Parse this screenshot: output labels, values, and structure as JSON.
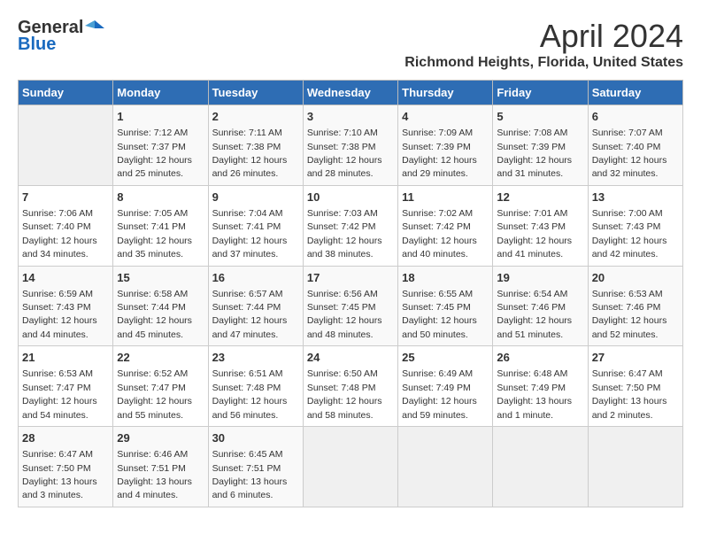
{
  "logo": {
    "general": "General",
    "blue": "Blue"
  },
  "title": "April 2024",
  "subtitle": "Richmond Heights, Florida, United States",
  "weekdays": [
    "Sunday",
    "Monday",
    "Tuesday",
    "Wednesday",
    "Thursday",
    "Friday",
    "Saturday"
  ],
  "weeks": [
    [
      {
        "day": "",
        "content": ""
      },
      {
        "day": "1",
        "content": "Sunrise: 7:12 AM\nSunset: 7:37 PM\nDaylight: 12 hours\nand 25 minutes."
      },
      {
        "day": "2",
        "content": "Sunrise: 7:11 AM\nSunset: 7:38 PM\nDaylight: 12 hours\nand 26 minutes."
      },
      {
        "day": "3",
        "content": "Sunrise: 7:10 AM\nSunset: 7:38 PM\nDaylight: 12 hours\nand 28 minutes."
      },
      {
        "day": "4",
        "content": "Sunrise: 7:09 AM\nSunset: 7:39 PM\nDaylight: 12 hours\nand 29 minutes."
      },
      {
        "day": "5",
        "content": "Sunrise: 7:08 AM\nSunset: 7:39 PM\nDaylight: 12 hours\nand 31 minutes."
      },
      {
        "day": "6",
        "content": "Sunrise: 7:07 AM\nSunset: 7:40 PM\nDaylight: 12 hours\nand 32 minutes."
      }
    ],
    [
      {
        "day": "7",
        "content": "Sunrise: 7:06 AM\nSunset: 7:40 PM\nDaylight: 12 hours\nand 34 minutes."
      },
      {
        "day": "8",
        "content": "Sunrise: 7:05 AM\nSunset: 7:41 PM\nDaylight: 12 hours\nand 35 minutes."
      },
      {
        "day": "9",
        "content": "Sunrise: 7:04 AM\nSunset: 7:41 PM\nDaylight: 12 hours\nand 37 minutes."
      },
      {
        "day": "10",
        "content": "Sunrise: 7:03 AM\nSunset: 7:42 PM\nDaylight: 12 hours\nand 38 minutes."
      },
      {
        "day": "11",
        "content": "Sunrise: 7:02 AM\nSunset: 7:42 PM\nDaylight: 12 hours\nand 40 minutes."
      },
      {
        "day": "12",
        "content": "Sunrise: 7:01 AM\nSunset: 7:43 PM\nDaylight: 12 hours\nand 41 minutes."
      },
      {
        "day": "13",
        "content": "Sunrise: 7:00 AM\nSunset: 7:43 PM\nDaylight: 12 hours\nand 42 minutes."
      }
    ],
    [
      {
        "day": "14",
        "content": "Sunrise: 6:59 AM\nSunset: 7:43 PM\nDaylight: 12 hours\nand 44 minutes."
      },
      {
        "day": "15",
        "content": "Sunrise: 6:58 AM\nSunset: 7:44 PM\nDaylight: 12 hours\nand 45 minutes."
      },
      {
        "day": "16",
        "content": "Sunrise: 6:57 AM\nSunset: 7:44 PM\nDaylight: 12 hours\nand 47 minutes."
      },
      {
        "day": "17",
        "content": "Sunrise: 6:56 AM\nSunset: 7:45 PM\nDaylight: 12 hours\nand 48 minutes."
      },
      {
        "day": "18",
        "content": "Sunrise: 6:55 AM\nSunset: 7:45 PM\nDaylight: 12 hours\nand 50 minutes."
      },
      {
        "day": "19",
        "content": "Sunrise: 6:54 AM\nSunset: 7:46 PM\nDaylight: 12 hours\nand 51 minutes."
      },
      {
        "day": "20",
        "content": "Sunrise: 6:53 AM\nSunset: 7:46 PM\nDaylight: 12 hours\nand 52 minutes."
      }
    ],
    [
      {
        "day": "21",
        "content": "Sunrise: 6:53 AM\nSunset: 7:47 PM\nDaylight: 12 hours\nand 54 minutes."
      },
      {
        "day": "22",
        "content": "Sunrise: 6:52 AM\nSunset: 7:47 PM\nDaylight: 12 hours\nand 55 minutes."
      },
      {
        "day": "23",
        "content": "Sunrise: 6:51 AM\nSunset: 7:48 PM\nDaylight: 12 hours\nand 56 minutes."
      },
      {
        "day": "24",
        "content": "Sunrise: 6:50 AM\nSunset: 7:48 PM\nDaylight: 12 hours\nand 58 minutes."
      },
      {
        "day": "25",
        "content": "Sunrise: 6:49 AM\nSunset: 7:49 PM\nDaylight: 12 hours\nand 59 minutes."
      },
      {
        "day": "26",
        "content": "Sunrise: 6:48 AM\nSunset: 7:49 PM\nDaylight: 13 hours\nand 1 minute."
      },
      {
        "day": "27",
        "content": "Sunrise: 6:47 AM\nSunset: 7:50 PM\nDaylight: 13 hours\nand 2 minutes."
      }
    ],
    [
      {
        "day": "28",
        "content": "Sunrise: 6:47 AM\nSunset: 7:50 PM\nDaylight: 13 hours\nand 3 minutes."
      },
      {
        "day": "29",
        "content": "Sunrise: 6:46 AM\nSunset: 7:51 PM\nDaylight: 13 hours\nand 4 minutes."
      },
      {
        "day": "30",
        "content": "Sunrise: 6:45 AM\nSunset: 7:51 PM\nDaylight: 13 hours\nand 6 minutes."
      },
      {
        "day": "",
        "content": ""
      },
      {
        "day": "",
        "content": ""
      },
      {
        "day": "",
        "content": ""
      },
      {
        "day": "",
        "content": ""
      }
    ]
  ]
}
